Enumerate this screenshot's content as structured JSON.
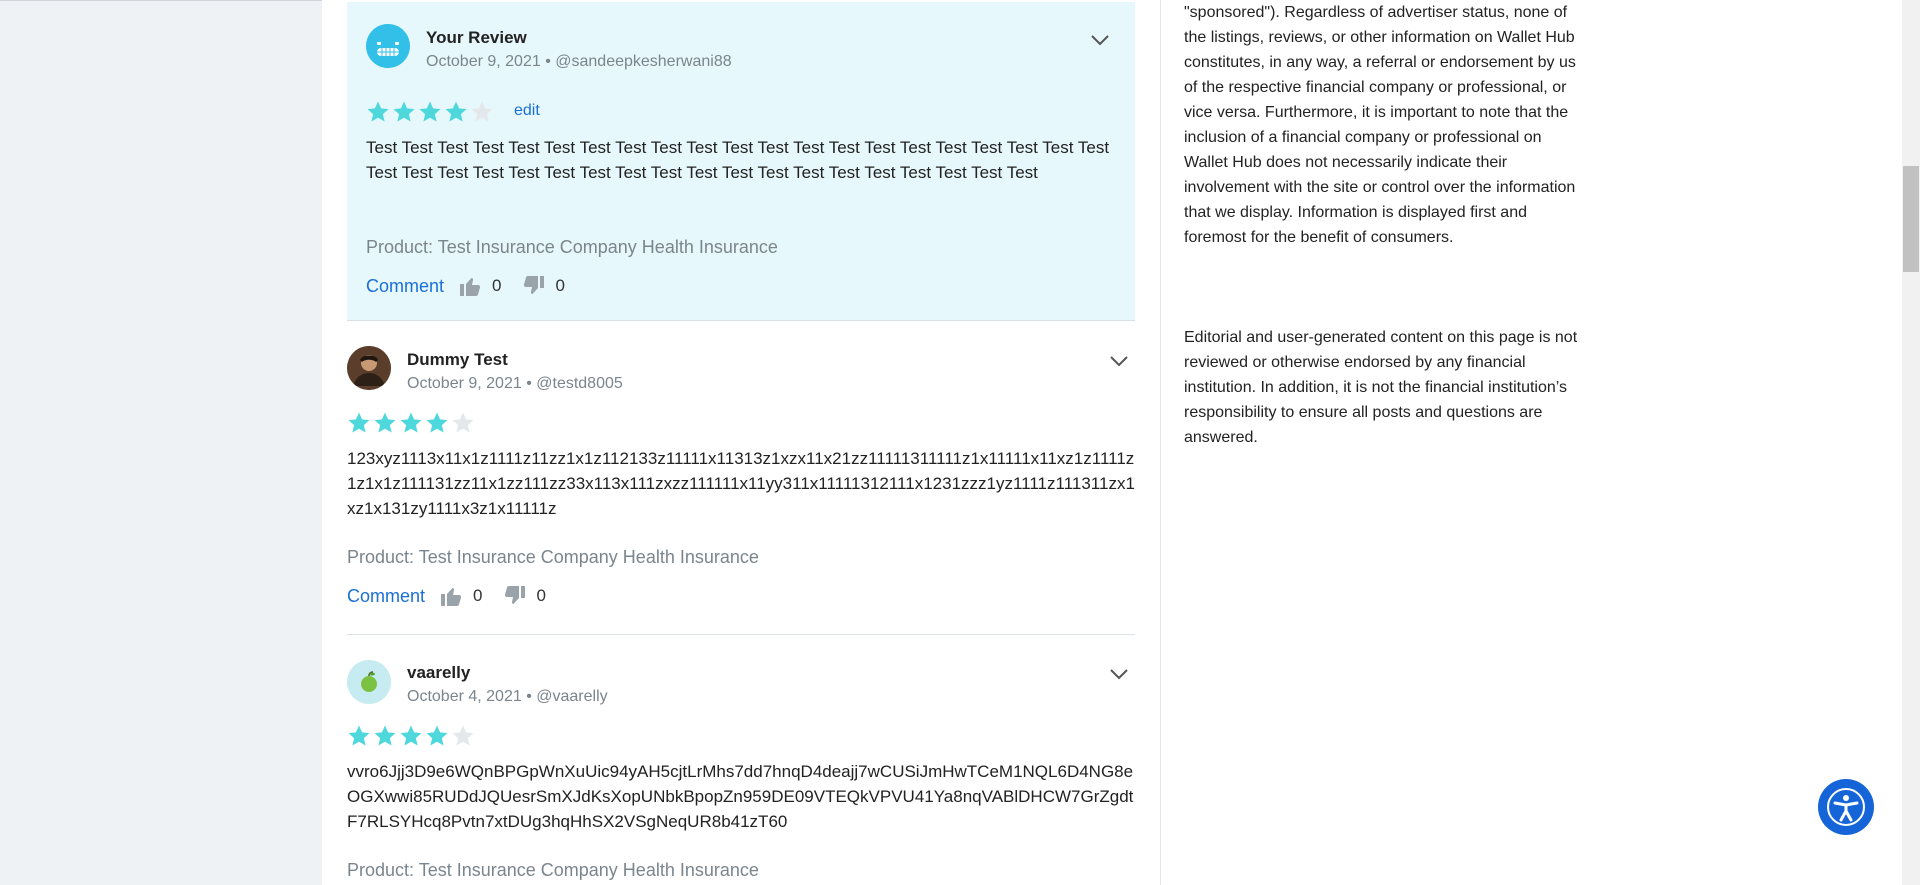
{
  "reviews": [
    {
      "name": "Your Review",
      "date": "October 9, 2021",
      "handle": "@sandeepkesherwani88",
      "rating": 4,
      "edit_label": "edit",
      "text": "Test Test Test Test Test Test Test Test Test Test Test Test Test Test Test Test Test Test Test Test Test Test Test Test Test Test Test Test Test Test Test Test Test Test Test Test Test Test Test Test",
      "product": "Product: Test Insurance Company Health Insurance",
      "comment_label": "Comment",
      "upvotes": "0",
      "downvotes": "0",
      "avatar_icon": "grinning-face-icon"
    },
    {
      "name": "Dummy Test",
      "date": "October 9, 2021",
      "handle": "@testd8005",
      "rating": 4,
      "text": "123xyz1113x11x1z1111z11zz1x1z112133z11111x11313z1xzx11x21zz11111311111z1x11111x11xz1z1111z1z1x1z111131zz11x1zz111zz33x113x111zxzz111111x11yy311x11111312111x1231zzz1yz1111z111311zx1xz1x131zy1111x3z1x11111z",
      "product": "Product: Test Insurance Company Health Insurance",
      "comment_label": "Comment",
      "upvotes": "0",
      "downvotes": "0",
      "avatar_icon": "user-photo-icon"
    },
    {
      "name": "vaarelly",
      "date": "October 4, 2021",
      "handle": "@vaarelly",
      "rating": 4,
      "text": "vvro6Jjj3D9e6WQnBPGpWnXuUic94yAH5cjtLrMhs7dd7hnqD4deajj7wCUSiJmHwTCeM1NQL6D4NG8eOGXwwi85RUDdJQUesrSmXJdKsXopUNbkBpopZn959DE09VTEQkVPVU41Ya8nqVABlDHCW7GrZgdtF7RLSYHcq8Pvtn7xtDUg3hqHhSX2VSgNeqUR8b41zT60",
      "product": "Product: Test Insurance Company Health Insurance",
      "avatar_icon": "green-apple-icon"
    }
  ],
  "disclaimer": {
    "p1": "\"sponsored\"). Regardless of advertiser status, none of the listings, reviews, or other information on Wallet Hub constitutes, in any way, a referral or endorsement by us of the respective financial company or professional, or vice versa. Furthermore, it is important to note that the inclusion of a financial company or professional on Wallet Hub does not necessarily indicate their involvement with the site or control over the information that we display. Information is displayed first and foremost for the benefit of consumers.",
    "p2": "Editorial and user-generated content on this page is not reviewed or otherwise endorsed by any financial institution. In addition, it is not the financial institution’s responsibility to ensure all posts and questions are answered."
  },
  "colors": {
    "star_filled": "#4fd8dc",
    "star_empty": "#e5e8ea",
    "link": "#1a6fd6",
    "accessibility_button": "#1565d8"
  },
  "icons": {
    "chevron": "chevron-down-icon",
    "thumb_up": "thumbs-up-icon",
    "thumb_down": "thumbs-down-icon",
    "accessibility": "accessibility-icon"
  }
}
